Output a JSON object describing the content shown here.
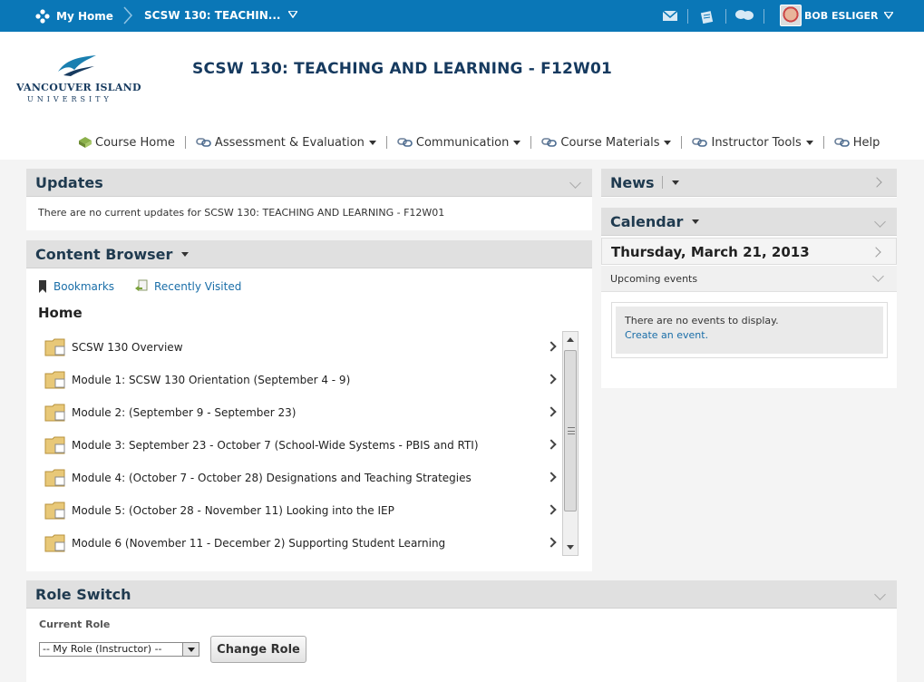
{
  "topbar": {
    "home_label": "My Home",
    "course_label": "SCSW 130: TEACHIN...",
    "user_name": "BOB ESLIGER",
    "icons": [
      "mail-icon",
      "updates-icon",
      "chat-icon"
    ]
  },
  "header": {
    "logo_line1": "VANCOUVER ISLAND",
    "logo_line2": "UNIVERSITY",
    "course_title": "SCSW 130: TEACHING AND LEARNING - F12W01"
  },
  "nav": {
    "items": [
      {
        "label": "Course Home"
      },
      {
        "label": "Assessment & Evaluation"
      },
      {
        "label": "Communication"
      },
      {
        "label": "Course Materials"
      },
      {
        "label": "Instructor Tools"
      },
      {
        "label": "Help"
      }
    ]
  },
  "updates": {
    "title": "Updates",
    "message": "There are no current updates for SCSW 130: TEACHING AND LEARNING - F12W01"
  },
  "content_browser": {
    "title": "Content Browser",
    "bookmarks_label": "Bookmarks",
    "recent_label": "Recently Visited",
    "home_label": "Home",
    "items": [
      {
        "label": "SCSW 130 Overview"
      },
      {
        "label": "Module 1: SCSW 130 Orientation (September 4 - 9)"
      },
      {
        "label": "Module 2: (September 9 - September 23)"
      },
      {
        "label": "Module 3: September 23 - October 7 (School-Wide Systems - PBIS and RTI)"
      },
      {
        "label": "Module 4: (October 7 - October 28) Designations and Teaching Strategies"
      },
      {
        "label": "Module 5: (October 28 - November 11) Looking into the IEP"
      },
      {
        "label": "Module 6 (November 11 - December 2) Supporting Student Learning"
      }
    ]
  },
  "news": {
    "title": "News"
  },
  "calendar": {
    "title": "Calendar",
    "date": "Thursday, March 21, 2013",
    "upcoming_label": "Upcoming events",
    "no_events": "There are no events to display.",
    "create_link": "Create an event."
  },
  "role_switch": {
    "title": "Role Switch",
    "current_role_label": "Current Role",
    "selected_role": "-- My Role (Instructor) --",
    "button_label": "Change Role"
  }
}
